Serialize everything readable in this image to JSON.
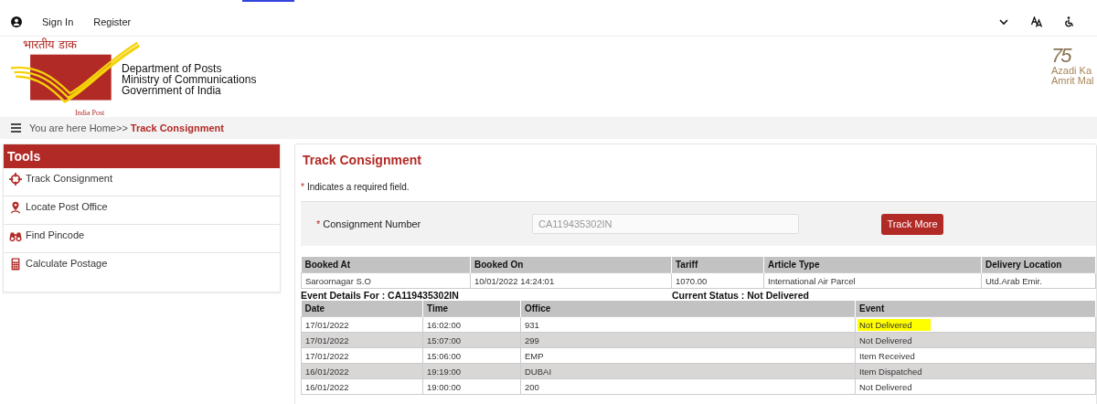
{
  "top_bar": {
    "links": [
      "Sign In",
      "Register"
    ]
  },
  "header": {
    "logo_hindi": "भारतीय डाक",
    "logo_caption": "India Post",
    "org_lines": [
      "Department of Posts",
      "Ministry of Communications",
      "Government of India"
    ],
    "azadi_number": "75",
    "azadi_lines": [
      "Azadi Ka",
      "Amrit Mal"
    ]
  },
  "breadcrumb": {
    "prefix": "You are here Home>>",
    "current": "Track Consignment"
  },
  "sidebar": {
    "title": "Tools",
    "items": [
      {
        "label": "Track Consignment"
      },
      {
        "label": "Locate Post Office"
      },
      {
        "label": "Find Pincode"
      },
      {
        "label": "Calculate Postage"
      }
    ]
  },
  "main": {
    "title": "Track Consignment",
    "required_mark": "*",
    "required_note": "Indicates a required field.",
    "form": {
      "label": "Consignment Number",
      "value": "CA119435302IN",
      "button": "Track More"
    },
    "booking_table": {
      "columns": [
        "Booked At",
        "Booked On",
        "Tariff",
        "Article Type",
        "Delivery Location"
      ],
      "row": [
        "Saroornagar S.O",
        "10/01/2022 14:24:01",
        "1070.00",
        "International Air Parcel",
        "Utd.Arab Emir."
      ]
    },
    "event_heading": "Event Details For : CA119435302IN",
    "current_status": "Current Status : Not Delivered",
    "events_table": {
      "columns": [
        "Date",
        "Time",
        "Office",
        "Event"
      ],
      "rows": [
        {
          "cells": [
            "17/01/2022",
            "16:02:00",
            "931",
            "Not Delivered"
          ],
          "highlighted": true
        },
        {
          "cells": [
            "17/01/2022",
            "15:07:00",
            "299",
            "Not Delivered"
          ],
          "highlighted": false
        },
        {
          "cells": [
            "17/01/2022",
            "15:06:00",
            "EMP",
            "Item Received"
          ],
          "highlighted": false
        },
        {
          "cells": [
            "16/01/2022",
            "19:19:00",
            "DUBAI",
            "Item Dispatched"
          ],
          "highlighted": false
        },
        {
          "cells": [
            "16/01/2022",
            "19:00:00",
            "200",
            "Not Delivered"
          ],
          "highlighted": false
        }
      ]
    }
  }
}
